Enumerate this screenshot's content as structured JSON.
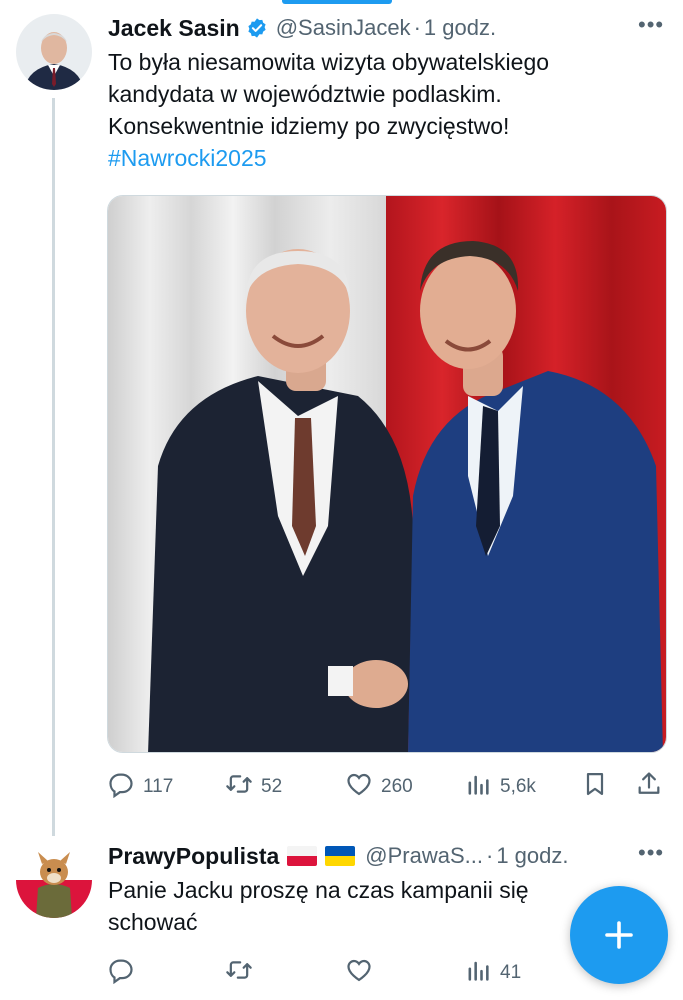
{
  "tweet": {
    "name": "Jacek Sasin",
    "handle": "@SasinJacek",
    "time": "1 godz.",
    "text_lines": [
      "To była niesamowita wizyta obywatelskiego",
      "kandydata w województwie podlaskim.",
      "Konsekwentnie idziemy po zwycięstwo!"
    ],
    "hashtag": "#Nawrocki2025",
    "stats": {
      "replies": "117",
      "retweets": "52",
      "likes": "260",
      "views": "5,6k"
    }
  },
  "reply": {
    "name": "PrawyPopulista",
    "handle": "@PrawaS...",
    "time": "1 godz.",
    "text_lines": [
      "Panie Jacku proszę na czas kampanii się",
      "schować"
    ],
    "stats": {
      "views": "41"
    }
  },
  "colors": {
    "accent": "#1d9bf0",
    "muted": "#536471",
    "text": "#0f1419"
  },
  "icons": [
    "verified-badge-icon",
    "more-icon",
    "reply-icon",
    "retweet-icon",
    "like-icon",
    "views-icon",
    "bookmark-icon",
    "share-icon",
    "compose-plus-icon"
  ]
}
